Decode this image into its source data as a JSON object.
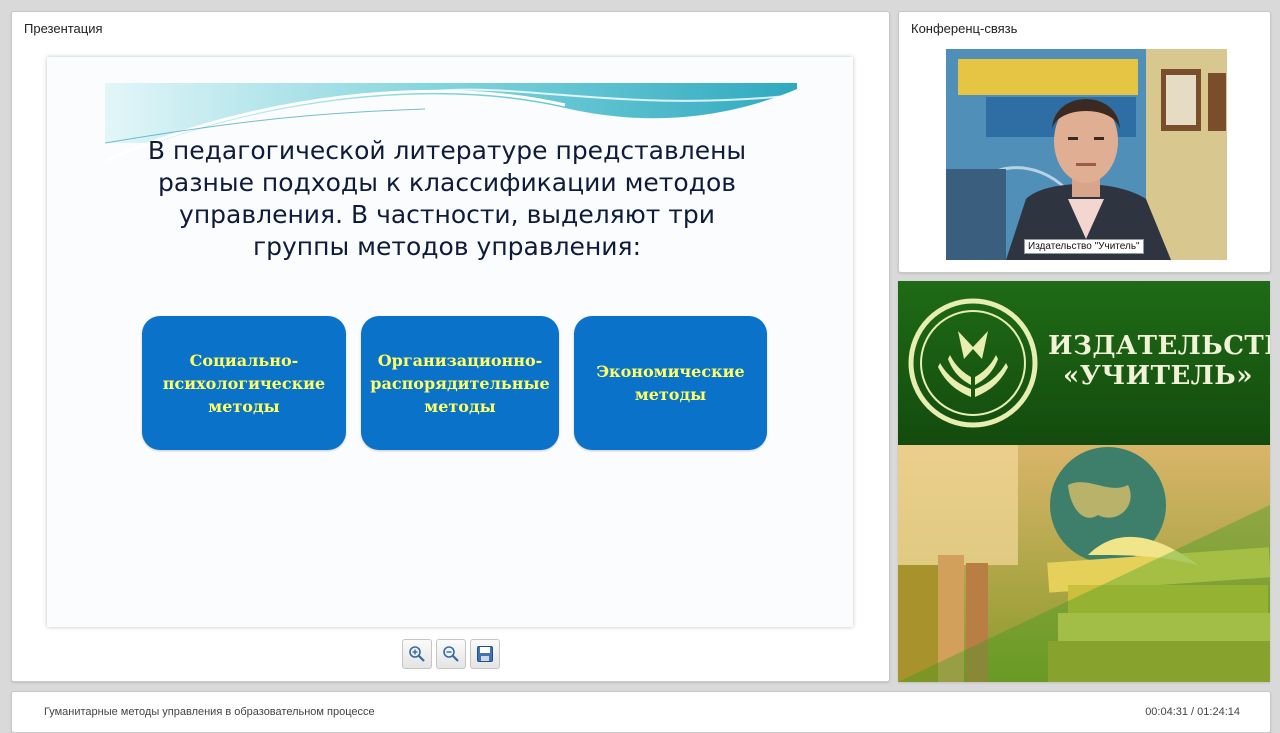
{
  "presentation": {
    "title": "Презентация",
    "slide": {
      "text": "В педагогической литературе представлены разные подходы к классификации методов управления. В частности, выделяют три группы методов управления:",
      "methods": [
        "Социально-\nпсихологические\nметоды",
        "Организационно-\nраспорядительные\nметоды",
        "Экономические\nметоды"
      ]
    },
    "toolbar": {
      "zoom_in": "zoom-in-icon",
      "zoom_out": "zoom-out-icon",
      "save": "save-icon"
    }
  },
  "conference": {
    "title": "Конференц-связь",
    "speaker_label": "Издательство \"Учитель\""
  },
  "banner": {
    "name": "ИЗДАТЕЛЬСТВО\n«УЧИТЕЛЬ»"
  },
  "footer": {
    "lecture_title": "Гуманитарные методы управления в образовательном процессе",
    "time": "00:04:31 / 01:24:14"
  },
  "colors": {
    "method_box": "#0a73c9",
    "method_text": "#ffff66",
    "banner_green": "#1f6b16"
  }
}
